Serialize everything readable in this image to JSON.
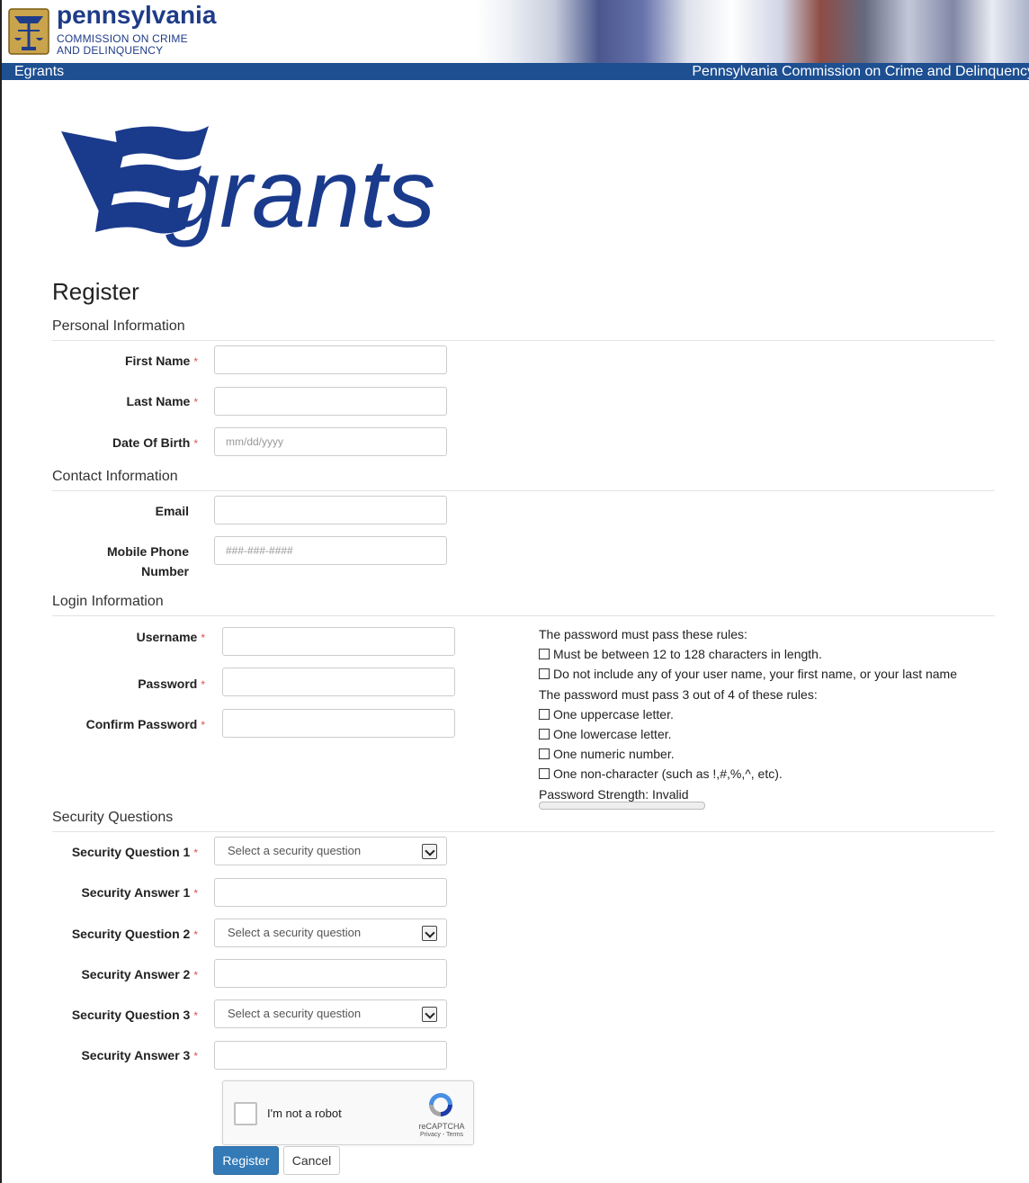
{
  "header": {
    "state": "pennsylvania",
    "subtitle_line1": "COMMISSION ON CRIME",
    "subtitle_line2": "AND DELINQUENCY",
    "nav_left": "Egrants",
    "nav_right": "Pennsylvania Commission on Crime and Delinquency",
    "brand_color": "#1d4f91"
  },
  "logo": {
    "text": "grants"
  },
  "page_title": "Register",
  "sections": {
    "personal": "Personal Information",
    "contact": "Contact Information",
    "login": "Login Information",
    "security": "Security Questions"
  },
  "fields": {
    "first_name": {
      "label": "First Name",
      "required_mark": "*",
      "value": ""
    },
    "last_name": {
      "label": "Last Name",
      "required_mark": "*",
      "value": ""
    },
    "dob": {
      "label": "Date Of Birth",
      "required_mark": "*",
      "placeholder": "mm/dd/yyyy"
    },
    "email": {
      "label": "Email",
      "value": ""
    },
    "mobile_line1": "Mobile Phone",
    "mobile_line2": "Number",
    "mobile_placeholder": "###-###-####",
    "username": {
      "label": "Username",
      "required_mark": "*"
    },
    "password": {
      "label": "Password",
      "required_mark": "*"
    },
    "confirm_password": {
      "label": "Confirm Password",
      "required_mark": "*"
    },
    "sq1": {
      "label": "Security Question 1",
      "required_mark": "*",
      "selected": "Select a security question"
    },
    "sa1": {
      "label": "Security Answer 1",
      "required_mark": "*"
    },
    "sq2": {
      "label": "Security Question 2",
      "required_mark": "*",
      "selected": "Select a security question"
    },
    "sa2": {
      "label": "Security Answer 2",
      "required_mark": "*"
    },
    "sq3": {
      "label": "Security Question 3",
      "required_mark": "*",
      "selected": "Select a security question"
    },
    "sa3": {
      "label": "Security Answer 3",
      "required_mark": "*"
    }
  },
  "password_rules": {
    "intro1": "The password must pass these rules:",
    "rule1": "Must be between 12 to 128 characters in length.",
    "rule2": "Do not include any of your user name, your first name, or your last name",
    "intro2": "The password must pass 3 out of 4 of these rules:",
    "rule3": "One uppercase letter.",
    "rule4": "One lowercase letter.",
    "rule5": "One numeric number.",
    "rule6": "One non-character (such as !,#,%,^, etc).",
    "strength": "Password Strength: Invalid"
  },
  "captcha": {
    "label": "I'm not a robot",
    "brand": "reCAPTCHA",
    "links": "Privacy - Terms"
  },
  "buttons": {
    "register": "Register",
    "cancel": "Cancel"
  },
  "colors": {
    "required": "#d9534f",
    "primary": "#337ab7"
  }
}
